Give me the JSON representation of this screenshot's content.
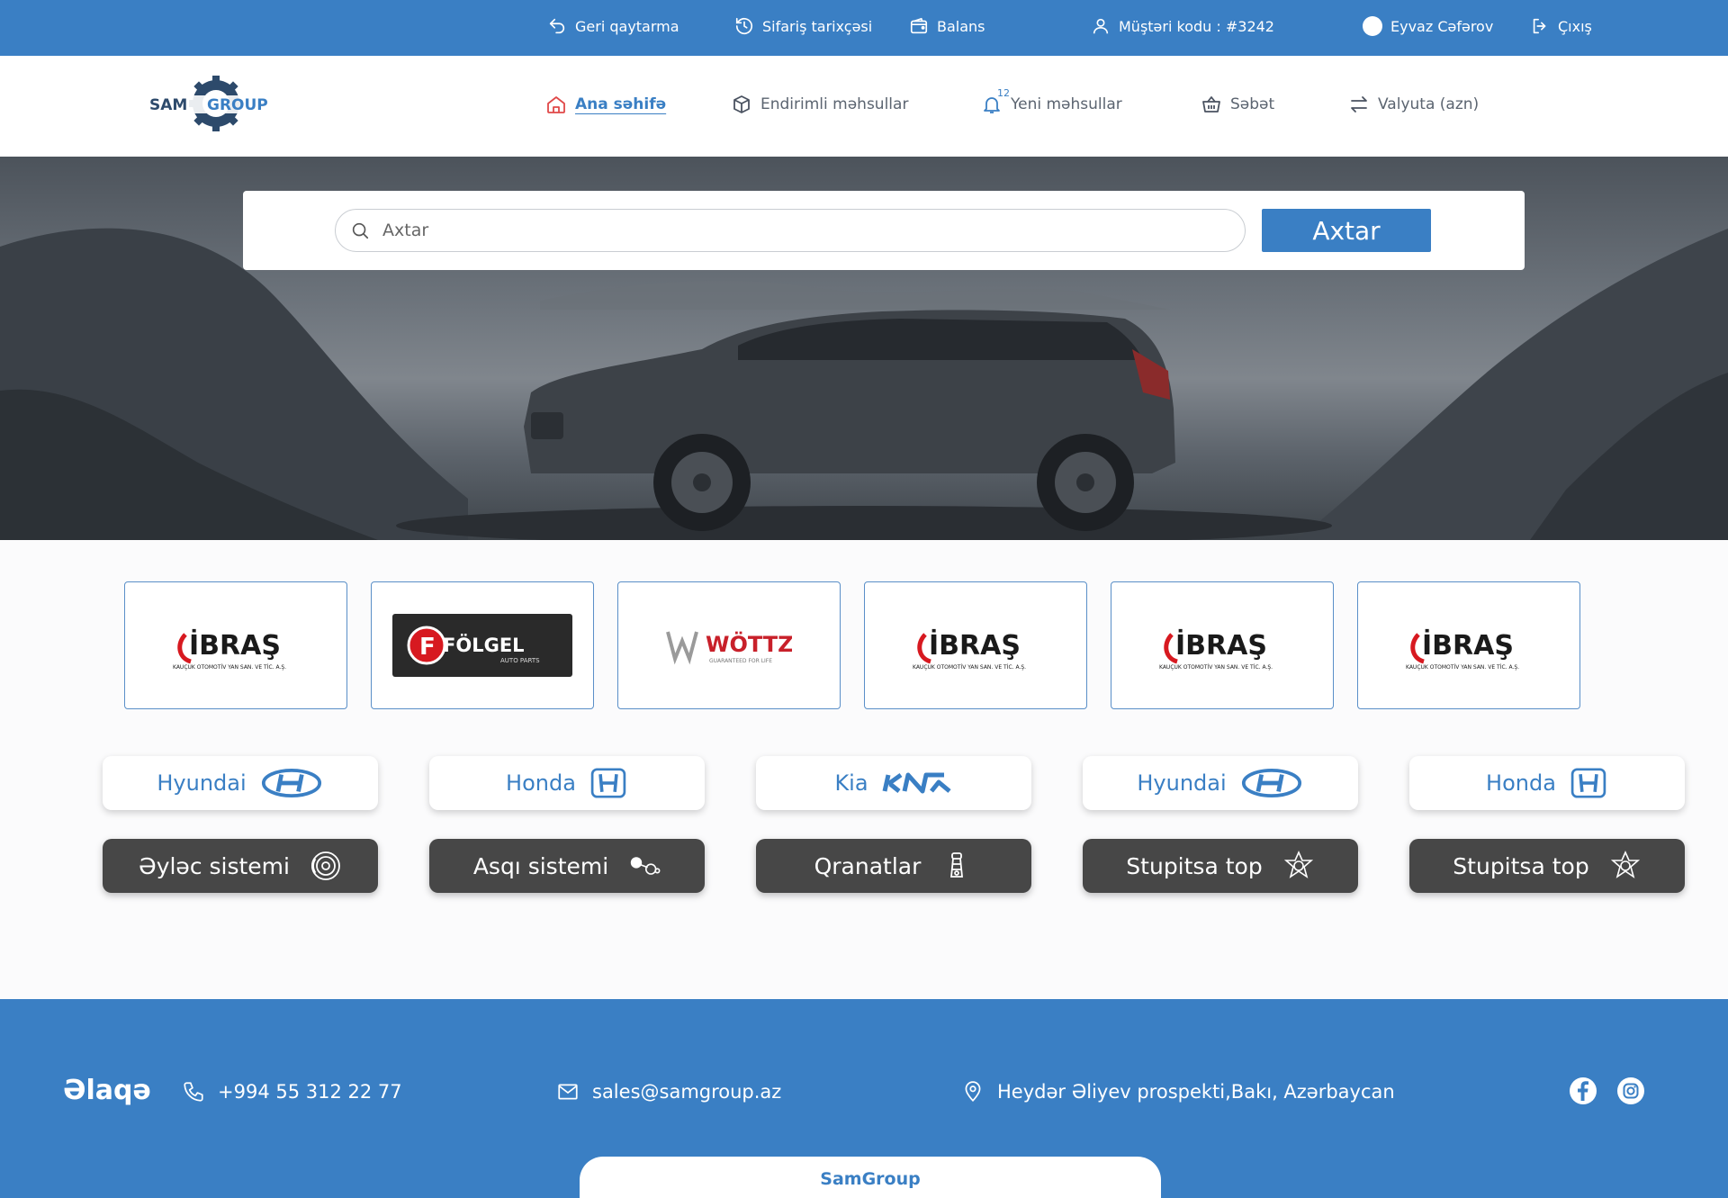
{
  "topbar": {
    "return_label": "Geri qaytarma",
    "orders_label": "Sifariş tarixçəsi",
    "balance_label": "Balans",
    "customer_code": "Müştəri kodu : #3242",
    "user_name": "Eyvaz Cəfərov",
    "logout_label": "Çıxış"
  },
  "brand": {
    "logo_text_1": "SAM",
    "logo_text_2": "GROUP"
  },
  "nav": {
    "home": "Ana səhifə",
    "discounted": "Endirimli məhsullar",
    "new_products": "Yeni məhsullar",
    "new_count": "12",
    "cart": "Səbət",
    "currency": "Valyuta (azn)"
  },
  "search": {
    "placeholder": "Axtar",
    "button": "Axtar"
  },
  "brands": [
    {
      "name": "İBRAŞ",
      "sub": "KAUÇUK OTOMOTİV YAN SAN. VE TİC. A.Ş."
    },
    {
      "name": "FÖLGEL",
      "sub": "AUTO PARTS"
    },
    {
      "name": "WÖTTZ",
      "sub": "GUARANTEED FOR LIFE"
    },
    {
      "name": "İBRAŞ",
      "sub": "KAUÇUK OTOMOTİV YAN SAN. VE TİC. A.Ş."
    },
    {
      "name": "İBRAŞ",
      "sub": "KAUÇUK OTOMOTİV YAN SAN. VE TİC. A.Ş."
    },
    {
      "name": "İBRAŞ",
      "sub": "KAUÇUK OTOMOTİV YAN SAN. VE TİC. A.Ş."
    }
  ],
  "makes": [
    {
      "label": "Hyundai",
      "icon": "hyundai-logo-icon"
    },
    {
      "label": "Honda",
      "icon": "honda-logo-icon"
    },
    {
      "label": "Kia",
      "icon": "kia-logo-icon"
    },
    {
      "label": "Hyundai",
      "icon": "hyundai-logo-icon"
    },
    {
      "label": "Honda",
      "icon": "honda-logo-icon"
    }
  ],
  "categories": [
    {
      "label": "Əyləc sistemi",
      "icon": "brake-disc-icon"
    },
    {
      "label": "Asqı sistemi",
      "icon": "suspension-icon"
    },
    {
      "label": "Qranatlar",
      "icon": "cv-joint-icon"
    },
    {
      "label": "Stupitsa top",
      "icon": "wheel-hub-icon"
    },
    {
      "label": "Stupitsa top",
      "icon": "wheel-hub-icon"
    }
  ],
  "footer": {
    "title": "Əlaqə",
    "phone": "+994 55 312 22 77",
    "email": "sales@samgroup.az",
    "address": "Heydər Əliyev prospekti,Bakı, Azərbaycan",
    "tab_label": "SamGroup"
  },
  "colors": {
    "primary": "#3a7fc4",
    "dark_card": "#474747",
    "brand_red": "#d71920"
  }
}
